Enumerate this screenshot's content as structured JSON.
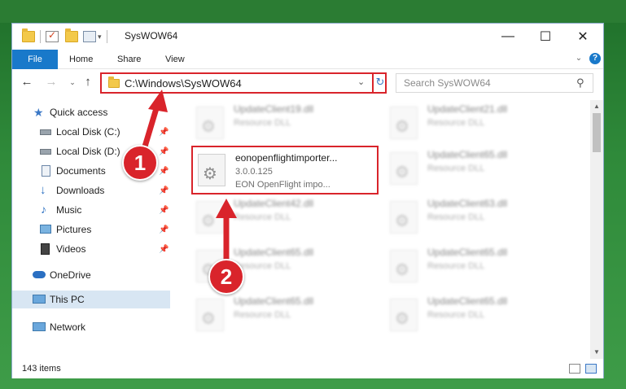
{
  "window": {
    "title": "SysWOW64",
    "min_glyph": "—",
    "max_glyph": "☐",
    "close_glyph": "✕"
  },
  "ribbon": {
    "tabs": [
      "File",
      "Home",
      "Share",
      "View"
    ],
    "expand_glyph": "⌄",
    "help_glyph": "?"
  },
  "address": {
    "path": "C:\\Windows\\SysWOW64",
    "dropdown_glyph": "⌄",
    "refresh_glyph": "↻"
  },
  "search": {
    "placeholder": "Search SysWOW64",
    "icon_glyph": "⚲"
  },
  "navigation": {
    "back_glyph": "←",
    "forward_glyph": "→",
    "recent_glyph": "⌄",
    "up_glyph": "↑"
  },
  "sidebar": {
    "pin_glyph": "📌",
    "items": [
      {
        "label": "Quick access",
        "icon": "star-icon",
        "pinned": false
      },
      {
        "label": "Local Disk (C:)",
        "icon": "drive-icon",
        "pinned": true
      },
      {
        "label": "Local Disk (D:)",
        "icon": "drive-icon",
        "pinned": true
      },
      {
        "label": "Documents",
        "icon": "documents-icon",
        "pinned": true
      },
      {
        "label": "Downloads",
        "icon": "downloads-icon",
        "pinned": true
      },
      {
        "label": "Music",
        "icon": "music-icon",
        "pinned": true
      },
      {
        "label": "Pictures",
        "icon": "pictures-icon",
        "pinned": true
      },
      {
        "label": "Videos",
        "icon": "videos-icon",
        "pinned": true
      },
      {
        "label": "OneDrive",
        "icon": "onedrive-icon",
        "pinned": false
      },
      {
        "label": "This PC",
        "icon": "pc-icon",
        "pinned": false,
        "selected": true
      },
      {
        "label": "Network",
        "icon": "network-icon",
        "pinned": false
      }
    ]
  },
  "files": [
    {
      "name": "UpdateClient19.dll",
      "type": "Resource DLL",
      "blurred": true
    },
    {
      "name": "UpdateClient21.dll",
      "type": "Resource DLL",
      "blurred": true
    },
    {
      "name": "eonopenflightimporter...",
      "version": "3.0.0.125",
      "description": "EON OpenFlight impo...",
      "blurred": false,
      "highlighted": true
    },
    {
      "name": "UpdateClient65.dll",
      "type": "Resource DLL",
      "blurred": true
    },
    {
      "name": "UpdateClient42.dll",
      "type": "Resource DLL",
      "blurred": true
    },
    {
      "name": "UpdateClient63.dll",
      "type": "Resource DLL",
      "blurred": true
    },
    {
      "name": "UpdateClient65.dll",
      "type": "Resource DLL",
      "blurred": true
    },
    {
      "name": "UpdateClient65.dll",
      "type": "Resource DLL",
      "blurred": true
    },
    {
      "name": "UpdateClient65.dll",
      "type": "Resource DLL",
      "blurred": true
    },
    {
      "name": "UpdateClient65.dll",
      "type": "Resource DLL",
      "blurred": true
    }
  ],
  "status": {
    "item_count": "143 items"
  },
  "callouts": [
    {
      "number": "1"
    },
    {
      "number": "2"
    }
  ],
  "colors": {
    "accent": "#1979ca",
    "highlight_red": "#d9242b",
    "selected_bg": "#d8e6f3"
  }
}
